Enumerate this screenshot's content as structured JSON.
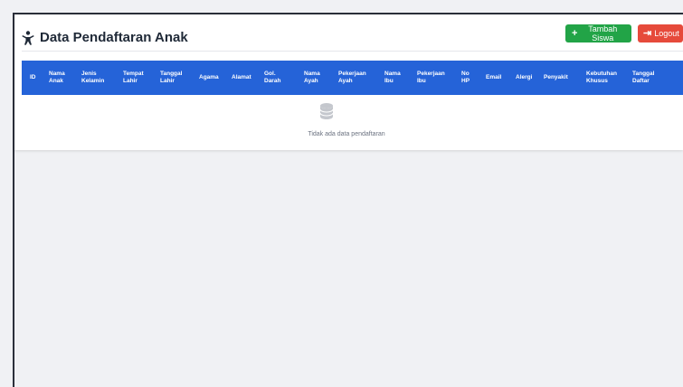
{
  "page": {
    "title": "Data Pendaftaran Anak",
    "title_icon": "child-icon"
  },
  "actions": {
    "add_icon": "plus-icon",
    "add_label": "Tambah Siswa",
    "logout_icon": "sign-out-icon",
    "logout_label": "Logout"
  },
  "table": {
    "columns": [
      "ID",
      "Nama\nAnak",
      "Jenis\nKelamin",
      "Tempat\nLahir",
      "Tanggal\nLahir",
      "Agama",
      "Alamat",
      "Gol.\nDarah",
      "Nama\nAyah",
      "Pekerjaan\nAyah",
      "Nama\nIbu",
      "Pekerjaan\nIbu",
      "No\nHP",
      "Email",
      "Alergi",
      "Penyakit",
      "Kebutuhan\nKhusus",
      "Tanggal\nDaftar"
    ],
    "rows": [],
    "empty_icon": "database-icon",
    "empty_message": "Tidak ada data pendaftaran"
  },
  "colors": {
    "header": "#2563d8",
    "add_button": "#22a447",
    "logout_button": "#e64a3b"
  }
}
